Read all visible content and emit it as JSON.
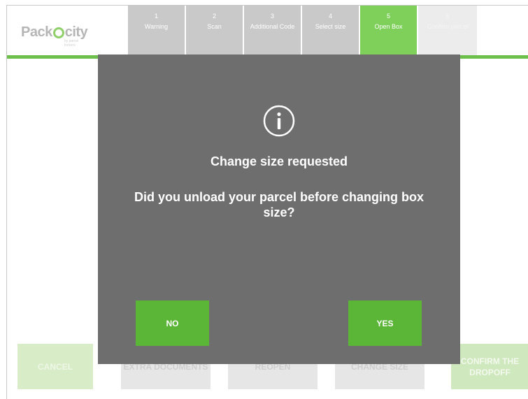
{
  "header": {
    "logo_left": "Pack",
    "logo_right": "city",
    "logo_tagline": "by parcel lockers",
    "steps": [
      {
        "num": "1",
        "label": "Warning"
      },
      {
        "num": "2",
        "label": "Scan"
      },
      {
        "num": "3",
        "label": "Additional Code"
      },
      {
        "num": "4",
        "label": "Select size"
      },
      {
        "num": "5",
        "label": "Open Box"
      },
      {
        "num": "6",
        "label": "Confirm parcel"
      }
    ]
  },
  "footer": {
    "cancel_label": "CANCEL",
    "btn2_label": "EXTRA DOCUMENTS",
    "btn3_label": "REOPEN",
    "btn4_label": "CHANGE SIZE",
    "confirm_label": "CONFIRM THE DROPOFF"
  },
  "modal": {
    "icon": "info-icon",
    "title": "Change size requested",
    "message": "Did you unload your parcel before changing box size?",
    "no_label": "NO",
    "yes_label": "YES"
  },
  "colors": {
    "accent_green": "#5bb536",
    "active_step": "#7ed05a",
    "overlay": "#6e6e6e"
  }
}
